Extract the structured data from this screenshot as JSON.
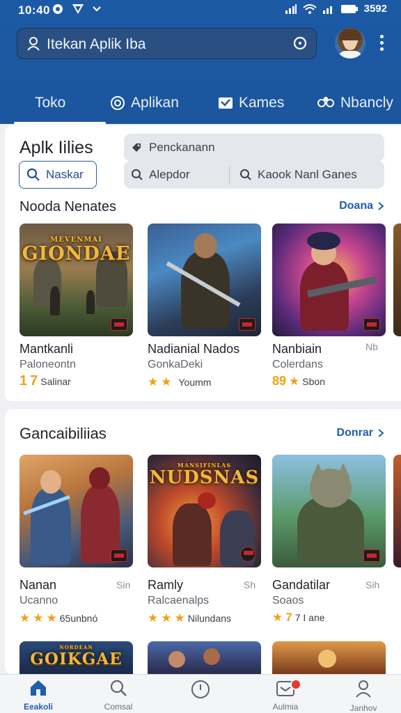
{
  "status_bar": {
    "time": "10:40",
    "battery": "3592"
  },
  "header": {
    "search_text": "Itekan Aplik Iba",
    "tabs": [
      {
        "label": "Toko",
        "icon": "none"
      },
      {
        "label": "Aplikan",
        "icon": "apps-icon"
      },
      {
        "label": "Kames",
        "icon": "games-icon"
      },
      {
        "label": "Nbancly",
        "icon": "gamepad-icon"
      }
    ],
    "accent": "#1d5aa5"
  },
  "card1": {
    "title": "Aplk Iilies",
    "search_button": "Naskar",
    "filter_top": "Penckanann",
    "filter_left": "Alepdor",
    "filter_right": "Kaook Nanl Ganes",
    "section_title": "Nooda Nenates",
    "section_link": "Doana",
    "apps": [
      {
        "name": "Mantkanli",
        "dev": "Paloneontn",
        "rating": "1",
        "rating_suffix": "7",
        "meta": "Salinar",
        "logo": "GIONDAE",
        "logo_top": "MEVENMAI",
        "side": ""
      },
      {
        "name": "Nadianial Nados",
        "dev": "GonkaDeki",
        "rating": "",
        "meta": "Youmm",
        "logo": "",
        "logo_top": "",
        "side": ""
      },
      {
        "name": "Nanbiain",
        "dev": "Colerdans",
        "rating": "89",
        "meta": "Sbon",
        "logo": "",
        "logo_top": "",
        "side": "Nb"
      }
    ]
  },
  "card2": {
    "section_title": "Gancaibiliias",
    "section_link": "Donrar",
    "apps": [
      {
        "name": "Nanan",
        "dev": "Ucanno",
        "meta": "65unbnó",
        "side": "Sin",
        "logo": ""
      },
      {
        "name": "Ramly",
        "dev": "Ralcaenalps",
        "meta": "Nilundans",
        "side": "Sh",
        "logo": "NUDSNAS",
        "logo_top": "MANSIFINLAS"
      },
      {
        "name": "Gandatilar",
        "dev": "Soaos",
        "meta": "7 I ane",
        "rating": "7",
        "side": "Sih",
        "logo": ""
      }
    ],
    "peek_logo": "GOIKGAE",
    "peek_logo_top": "NORDEAN"
  },
  "bottom_nav": [
    {
      "label": "Eeakoli",
      "icon": "home-icon",
      "active": true
    },
    {
      "label": "Comsal",
      "icon": "search-icon",
      "active": false
    },
    {
      "label": "",
      "icon": "clock-icon",
      "active": false
    },
    {
      "label": "Aulmia",
      "icon": "inbox-icon",
      "active": false
    },
    {
      "label": "Janhov",
      "icon": "profile-icon",
      "active": false
    }
  ]
}
